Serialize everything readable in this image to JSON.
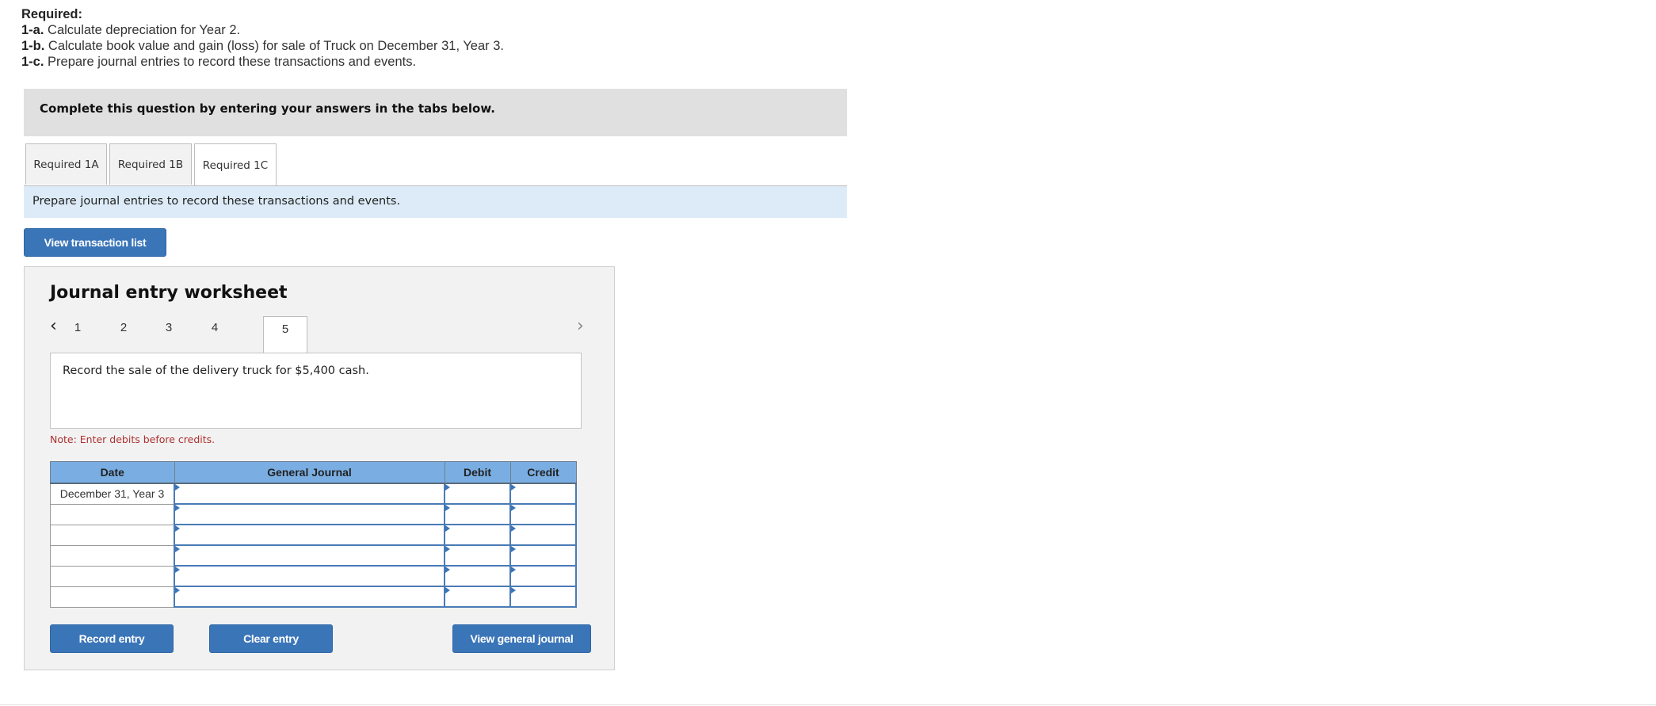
{
  "required": {
    "heading": "Required:",
    "items": [
      {
        "label": "1-a.",
        "text": " Calculate depreciation for Year 2."
      },
      {
        "label": "1-b.",
        "text": " Calculate book value and gain (loss) for sale of Truck on December 31, Year 3."
      },
      {
        "label": "1-c.",
        "text": " Prepare journal entries to record these transactions and events."
      }
    ]
  },
  "instructions_banner": "Complete this question by entering your answers in the tabs below.",
  "tabs": [
    {
      "label": "Required 1A",
      "active": false
    },
    {
      "label": "Required 1B",
      "active": false
    },
    {
      "label": "Required 1C",
      "active": true
    }
  ],
  "tab_instruction": "Prepare journal entries to record these transactions and events.",
  "view_transaction_list_label": "View transaction list",
  "worksheet": {
    "title": "Journal entry worksheet",
    "prev_icon": "‹",
    "next_icon": "›",
    "steps": [
      "1",
      "2",
      "3",
      "4",
      "5"
    ],
    "active_step": "5",
    "description": "Record the sale of the delivery truck for $5,400 cash.",
    "note": "Note: Enter debits before credits.",
    "table": {
      "headers": [
        "Date",
        "General Journal",
        "Debit",
        "Credit"
      ],
      "rows": [
        {
          "date": "December 31, Year 3",
          "account": "",
          "debit": "",
          "credit": ""
        },
        {
          "date": "",
          "account": "",
          "debit": "",
          "credit": ""
        },
        {
          "date": "",
          "account": "",
          "debit": "",
          "credit": ""
        },
        {
          "date": "",
          "account": "",
          "debit": "",
          "credit": ""
        },
        {
          "date": "",
          "account": "",
          "debit": "",
          "credit": ""
        },
        {
          "date": "",
          "account": "",
          "debit": "",
          "credit": ""
        }
      ]
    },
    "buttons": {
      "record": "Record entry",
      "clear": "Clear entry",
      "view_general_journal": "View general journal"
    }
  },
  "colors": {
    "button_blue": "#3a75b8",
    "table_header_blue": "#7aaee3",
    "instruction_bar": "#dcebf7",
    "banner_gray": "#e0e0e0",
    "note_red": "#b03030"
  }
}
